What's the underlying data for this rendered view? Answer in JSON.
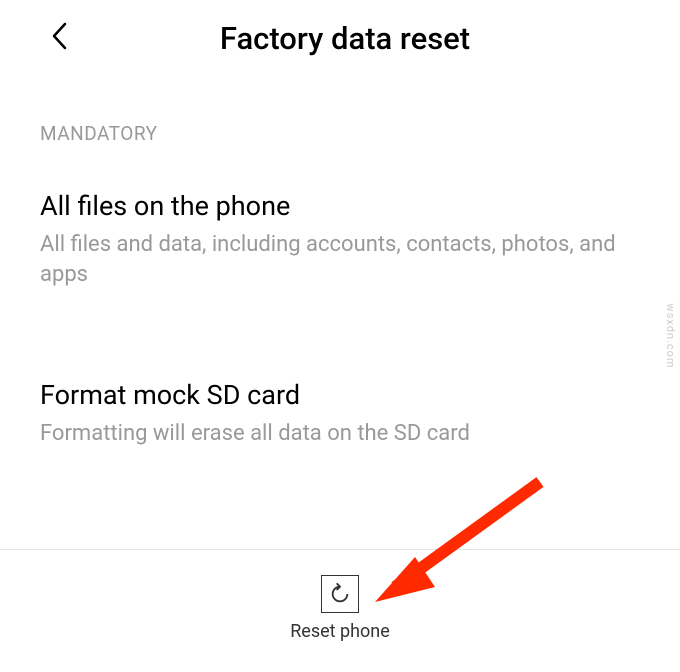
{
  "header": {
    "title": "Factory data reset"
  },
  "section": {
    "label": "MANDATORY"
  },
  "items": [
    {
      "title": "All files on the phone",
      "description": "All files and data, including accounts, contacts, photos, and apps"
    },
    {
      "title": "Format mock SD card",
      "description": "Formatting will erase all data on the SD card"
    }
  ],
  "footer": {
    "reset_label": "Reset phone"
  },
  "watermark": "wsxdn.com"
}
